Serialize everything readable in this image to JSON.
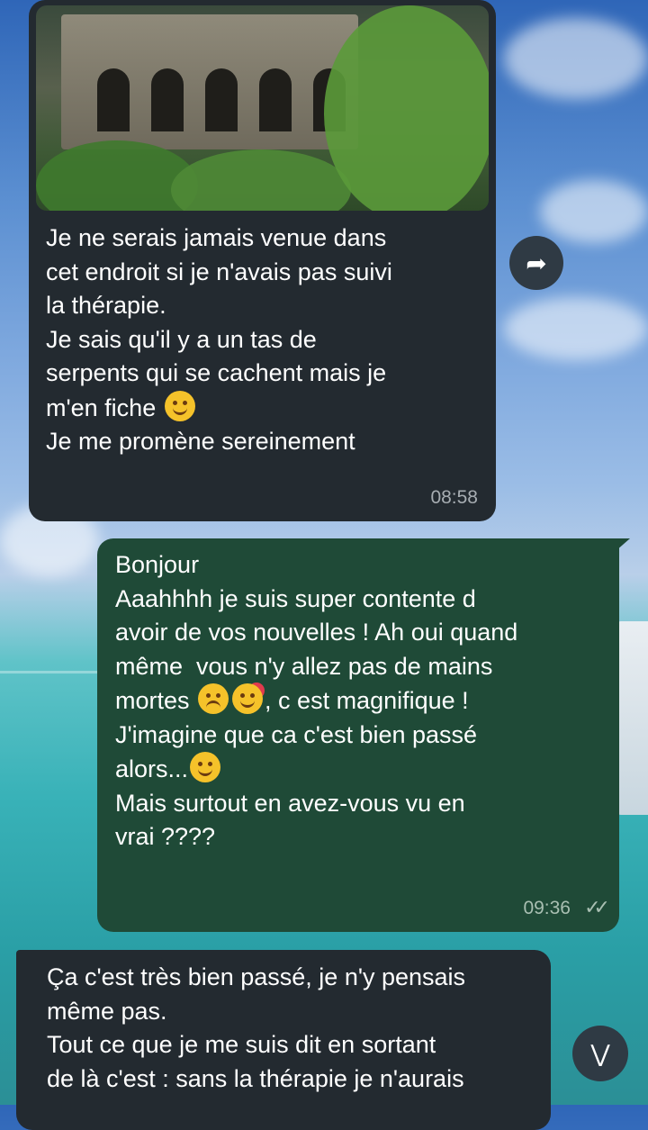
{
  "messages": [
    {
      "direction": "incoming",
      "has_photo": true,
      "lines": [
        "Je ne serais jamais venue dans",
        "cet endroit si je n'avais pas suivi",
        "la thérapie.",
        "Je sais qu'il y a un tas de",
        "serpents qui se cachent mais je",
        "m'en fiche",
        "Je me promène sereinement"
      ],
      "time": "08:58"
    },
    {
      "direction": "outgoing",
      "lines": [
        "Bonjour",
        "",
        "Aaahhhh je suis super contente d",
        "avoir de vos nouvelles ! Ah oui quand",
        "même  vous n'y allez pas de mains",
        "mortes",
        ", c est magnifique !",
        "J'imagine que ca c'est bien passé",
        "alors...",
        "Mais surtout en avez-vous vu en",
        "vrai ????"
      ],
      "time": "09:36",
      "status": "read"
    },
    {
      "direction": "incoming",
      "lines": [
        "Ça c'est très bien passé, je n'y pensais",
        "même pas.",
        "Tout ce que je me suis dit en sortant",
        "de là c'est : sans la thérapie je n'aurais"
      ]
    }
  ],
  "icons": {
    "forward": "forward-icon",
    "scroll_down": "double-chevron-down-icon"
  },
  "colors": {
    "incoming_bubble": "#232a30",
    "outgoing_bubble": "#1f4a37"
  }
}
